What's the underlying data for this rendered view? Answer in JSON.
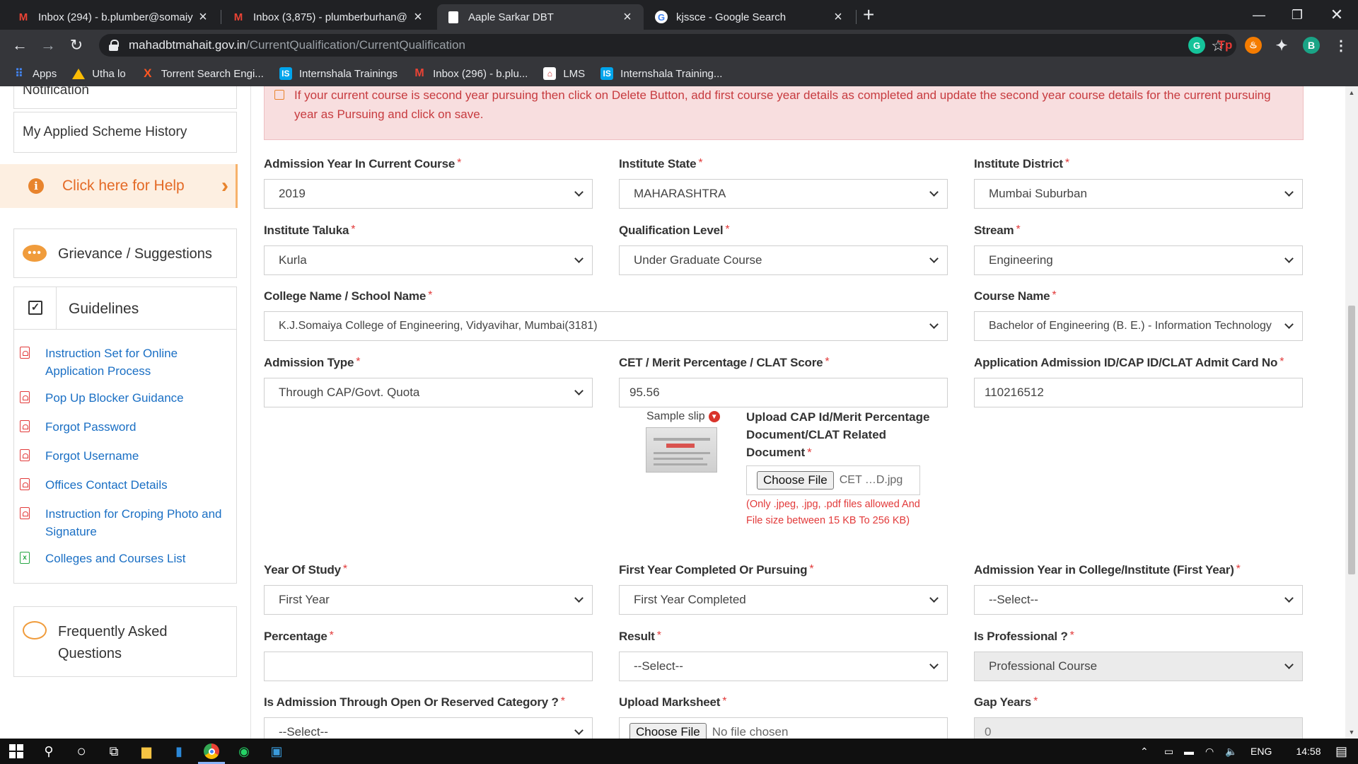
{
  "browser": {
    "tabs": [
      {
        "title": "Inbox (294) - b.plumber@somaiy",
        "favicon": "gmail-icon",
        "color": "#ea4335"
      },
      {
        "title": "Inbox (3,875) - plumberburhan@",
        "favicon": "gmail-icon",
        "color": "#ea4335"
      },
      {
        "title": "Aaple Sarkar DBT",
        "favicon": "page-icon",
        "color": "#ffffff"
      },
      {
        "title": "kjssce - Google Search",
        "favicon": "google-icon",
        "color": "#4285f4"
      }
    ],
    "url_host": "mahadbtmahait.gov.in",
    "url_path": "/CurrentQualification/CurrentQualification",
    "profile_initial": "B",
    "ext_grammarly": "G",
    "ext_tp": "Tp",
    "bookmarks": [
      {
        "label": "Apps",
        "icon": "apps-grid-icon"
      },
      {
        "label": "Utha lo",
        "icon": "drive-icon"
      },
      {
        "label": "Torrent Search Engi...",
        "icon": "x-icon"
      },
      {
        "label": "Internshala Trainings",
        "icon": "internshala-icon"
      },
      {
        "label": "Inbox (296) - b.plu...",
        "icon": "gmail-icon"
      },
      {
        "label": "LMS",
        "icon": "lms-icon"
      },
      {
        "label": "Internshala Training...",
        "icon": "internshala-icon"
      }
    ]
  },
  "sidebar": {
    "notification": "Notification",
    "history": "My Applied Scheme History",
    "help": "Click here for Help",
    "grievance": "Grievance / Suggestions",
    "guidelines_title": "Guidelines",
    "guidelines": [
      {
        "label": "Instruction Set for Online Application Process",
        "icon": "pdf-icon"
      },
      {
        "label": "Pop Up Blocker Guidance",
        "icon": "pdf-icon"
      },
      {
        "label": "Forgot Password",
        "icon": "pdf-icon"
      },
      {
        "label": "Forgot Username",
        "icon": "pdf-icon"
      },
      {
        "label": "Offices Contact Details",
        "icon": "pdf-icon"
      },
      {
        "label": "Instruction for Croping Photo and Signature",
        "icon": "pdf-icon"
      },
      {
        "label": "Colleges and Courses List",
        "icon": "excel-icon"
      }
    ],
    "faq": "Frequently Asked Questions"
  },
  "alert": {
    "text": "If your current course is second year pursuing then click on Delete Button, add first course year details as completed and update the second year course details for the current pursuing year as Pursuing and click on save."
  },
  "form": {
    "admission_year": {
      "label": "Admission Year In Current Course",
      "value": "2019"
    },
    "institute_state": {
      "label": "Institute State",
      "value": "MAHARASHTRA"
    },
    "institute_district": {
      "label": "Institute District",
      "value": "Mumbai Suburban"
    },
    "institute_taluka": {
      "label": "Institute Taluka",
      "value": "Kurla"
    },
    "qualification_level": {
      "label": "Qualification Level",
      "value": "Under Graduate Course"
    },
    "stream": {
      "label": "Stream",
      "value": "Engineering"
    },
    "college_name": {
      "label": "College Name / School Name",
      "value": "K.J.Somaiya College of Engineering, Vidyavihar, Mumbai(3181)"
    },
    "course_name": {
      "label": "Course Name",
      "value": "Bachelor of Engineering (B. E.) - Information Technology"
    },
    "admission_type": {
      "label": "Admission Type",
      "value": "Through CAP/Govt. Quota"
    },
    "cet_score": {
      "label": "CET / Merit Percentage / CLAT Score",
      "value": "95.56"
    },
    "admission_id": {
      "label": "Application Admission ID/CAP ID/CLAT Admit Card No",
      "value": "110216512"
    },
    "sample_slip": "Sample slip",
    "upload_cap": {
      "label": "Upload CAP Id/Merit Percentage Document/CLAT Related Document",
      "button": "Choose File",
      "filename": "CET …D.jpg",
      "note": "(Only .jpeg, .jpg, .pdf files allowed And File size between 15 KB To 256 KB)"
    },
    "year_of_study": {
      "label": "Year Of Study",
      "value": "First Year"
    },
    "first_year_status": {
      "label": "First Year Completed Or Pursuing",
      "value": "First Year Completed"
    },
    "admission_year_college": {
      "label": "Admission Year in College/Institute (First Year)",
      "value": "--Select--"
    },
    "percentage": {
      "label": "Percentage",
      "value": ""
    },
    "result": {
      "label": "Result",
      "value": "--Select--"
    },
    "is_professional": {
      "label": "Is Professional ?",
      "value": "Professional Course"
    },
    "category": {
      "label": "Is Admission Through Open Or Reserved Category ?",
      "value": "--Select--"
    },
    "upload_marksheet": {
      "label": "Upload Marksheet",
      "button": "Choose File",
      "filename": "No file chosen"
    },
    "gap_years": {
      "label": "Gap Years",
      "value": "0"
    }
  },
  "taskbar": {
    "lang": "ENG",
    "time": "14:58"
  }
}
